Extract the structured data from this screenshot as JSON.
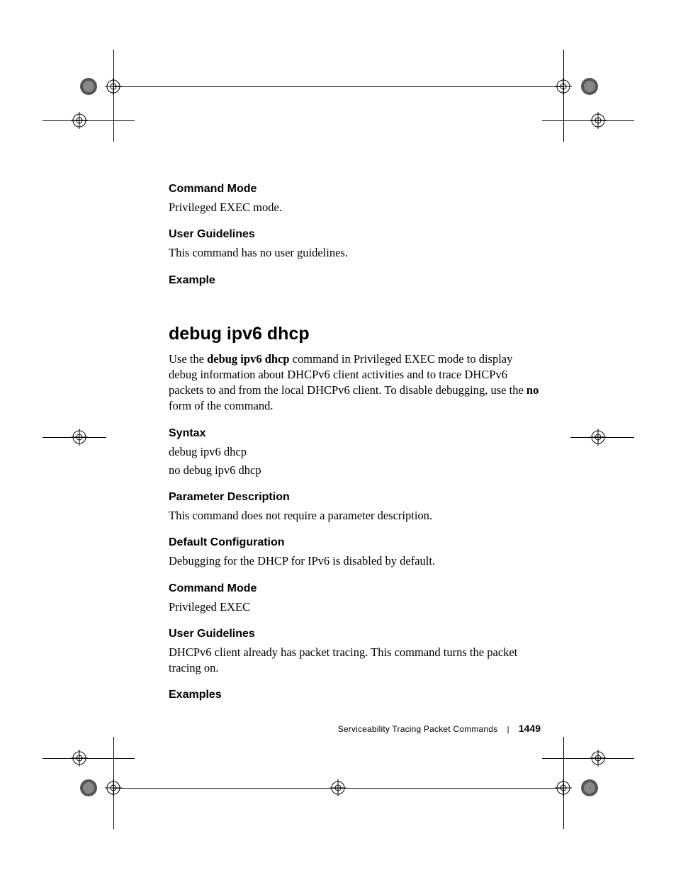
{
  "sections": {
    "command_mode_1": {
      "heading": "Command Mode",
      "body": "Privileged EXEC mode."
    },
    "user_guidelines_1": {
      "heading": "User Guidelines",
      "body": "This command has no user guidelines."
    },
    "example_1": {
      "heading": "Example"
    }
  },
  "command": {
    "title": "debug ipv6 dhcp",
    "intro_pre": "Use the ",
    "intro_bold": "debug ipv6 dhcp",
    "intro_mid": " command in Privileged EXEC mode to display debug information about DHCPv6 client activities and to trace DHCPv6 packets to and from the local DHCPv6 client. To disable debugging, use the ",
    "intro_bold2": "no",
    "intro_post": " form of the command."
  },
  "sections2": {
    "syntax": {
      "heading": "Syntax",
      "line1": "debug ipv6 dhcp",
      "line2": "no debug ipv6 dhcp"
    },
    "param_desc": {
      "heading": "Parameter Description",
      "body": "This command does not require a parameter description."
    },
    "default_config": {
      "heading": "Default Configuration",
      "body": "Debugging for the DHCP for IPv6 is disabled by default."
    },
    "command_mode_2": {
      "heading": "Command Mode",
      "body": "Privileged EXEC"
    },
    "user_guidelines_2": {
      "heading": "User Guidelines",
      "body": "DHCPv6 client already has packet tracing.  This command turns the packet tracing on."
    },
    "examples": {
      "heading": "Examples"
    }
  },
  "footer": {
    "title": "Serviceability Tracing Packet Commands",
    "page": "1449"
  }
}
